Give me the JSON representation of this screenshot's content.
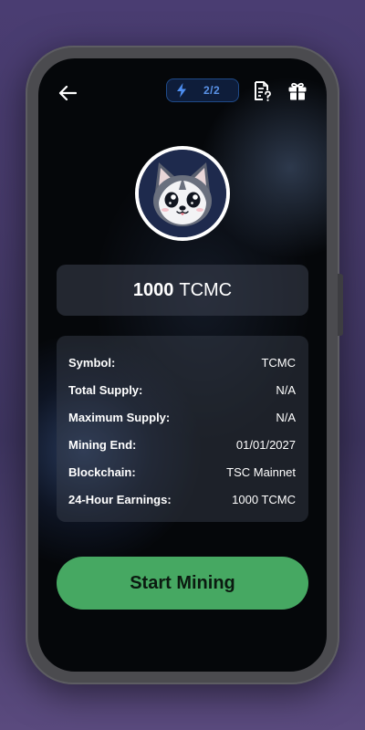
{
  "header": {
    "back_icon": "arrow-left-icon",
    "energy": {
      "icon": "lightning-bolt-icon",
      "count": "2/2"
    },
    "docs_icon": "document-question-icon",
    "gift_icon": "gift-icon"
  },
  "avatar": {
    "icon": "husky-dog-logo"
  },
  "balance": {
    "amount": "1000",
    "unit": "TCMC"
  },
  "details": [
    {
      "label": "Symbol:",
      "value": "TCMC"
    },
    {
      "label": "Total Supply:",
      "value": "N/A"
    },
    {
      "label": "Maximum Supply:",
      "value": "N/A"
    },
    {
      "label": "Mining End:",
      "value": "01/01/2027"
    },
    {
      "label": "Blockchain:",
      "value": "TSC Mainnet"
    },
    {
      "label": "24-Hour Earnings:",
      "value": "1000 TCMC"
    }
  ],
  "actions": {
    "start_label": "Start Mining"
  },
  "colors": {
    "accent_green": "#46a862",
    "energy_blue": "#5a93e8",
    "screen_bg": "#05070a"
  }
}
